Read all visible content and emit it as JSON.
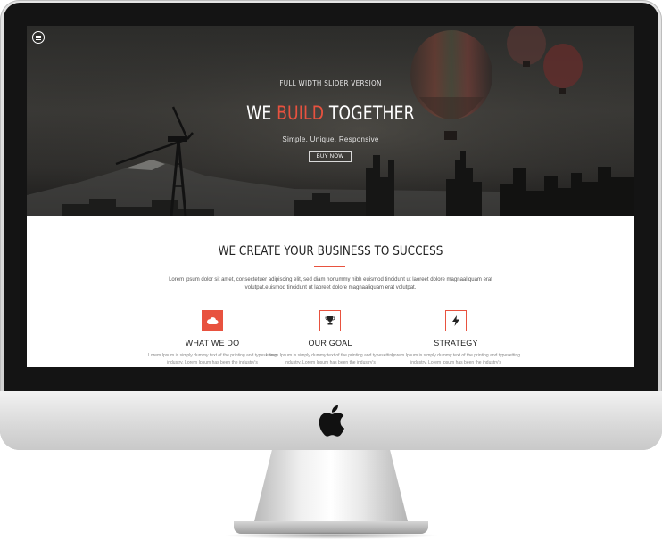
{
  "hero": {
    "eyebrow": "FULL WIDTH SLIDER VERSION",
    "title_part1": "WE ",
    "title_accent": "BUILD",
    "title_part2": " TOGETHER",
    "subtitle": "Simple. Unique. Responsive",
    "button_label": "BUY NOW",
    "menu_icon": "menu-icon"
  },
  "intro": {
    "title": "WE CREATE YOUR BUSINESS TO SUCCESS",
    "text": "Lorem ipsum dolor sit amet, consectetuer adipiscing elit, sed diam nonummy nibh euismod tincidunt ut laoreet dolore magnaaliquam erat volutpat.euismod tincidunt ut laoreet dolore magnaaliquam erat volutpat."
  },
  "features": [
    {
      "title": "WHAT WE DO",
      "icon": "cloud-icon",
      "text": "Lorem Ipsum is simply dummy text of the printing and typesetting industry. Lorem Ipsum has been the industry's"
    },
    {
      "title": "OUR GOAL",
      "icon": "trophy-icon",
      "text": "Lorem Ipsum is simply dummy text of the printing and typesetting industry. Lorem Ipsum has been the industry's"
    },
    {
      "title": "STRATEGY",
      "icon": "lightning-icon",
      "text": "Lorem Ipsum is simply dummy text of the printing and typesetting industry. Lorem Ipsum has been the industry's"
    }
  ],
  "colors": {
    "accent": "#e8523f",
    "hero_text": "#ffffff",
    "heading": "#222222",
    "body_text": "#555555",
    "device_frame": "#141414"
  },
  "device": {
    "logo_icon": "apple-logo-icon"
  }
}
